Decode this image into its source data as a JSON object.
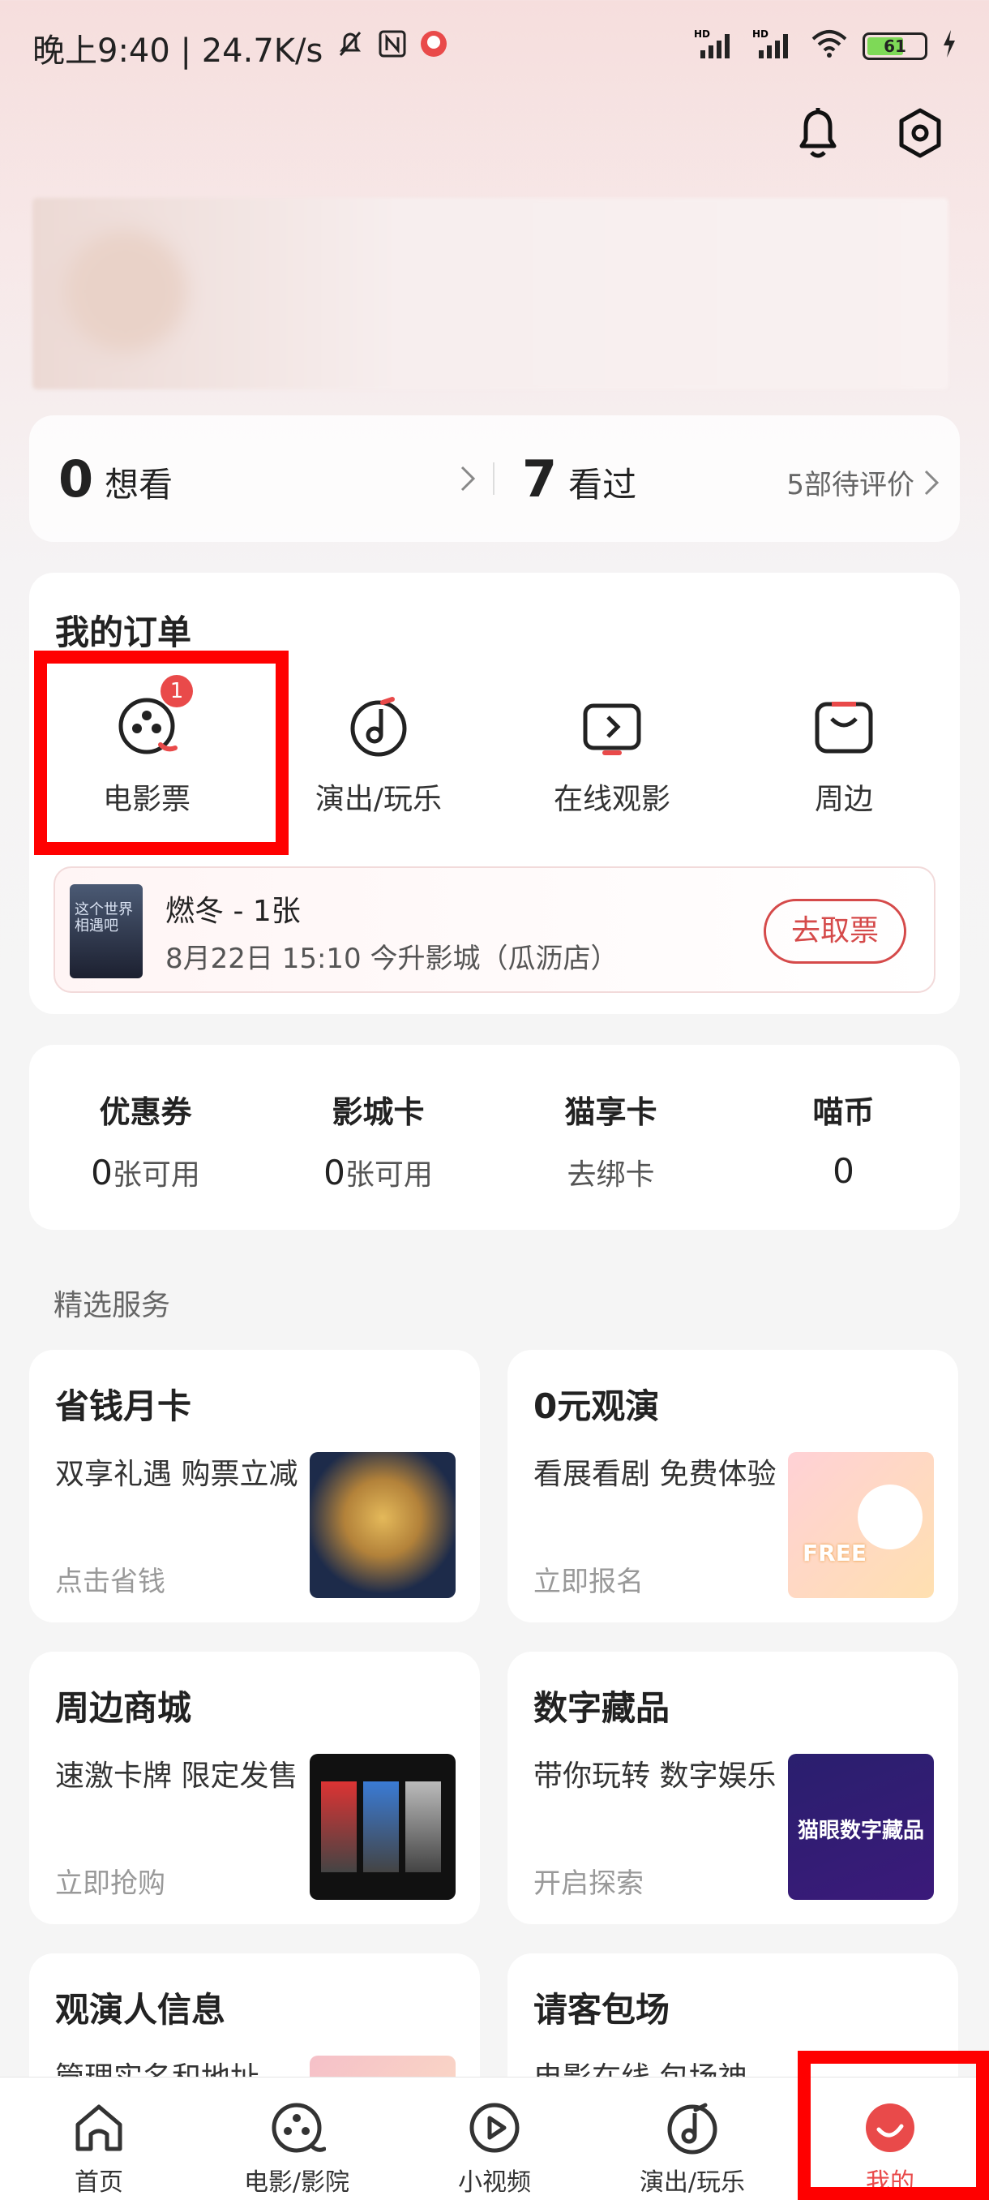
{
  "status_bar": {
    "time_speed": "晚上9:40 | 24.7K/s",
    "battery": "61"
  },
  "stats": {
    "want_count": "0",
    "want_label": "想看",
    "watched_count": "7",
    "watched_label": "看过",
    "pending_reviews": "5部待评价"
  },
  "orders": {
    "title": "我的订单",
    "items": [
      {
        "label": "电影票",
        "badge": "1"
      },
      {
        "label": "演出/玩乐"
      },
      {
        "label": "在线观影"
      },
      {
        "label": "周边"
      }
    ],
    "ticket": {
      "poster_text": "这个世界相遇吧",
      "title": "燃冬 - 1张",
      "info": "8月22日 15:10 今升影城（瓜沥店）",
      "button": "去取票"
    }
  },
  "benefits": [
    {
      "title": "优惠券",
      "count": "0",
      "suffix": "张可用"
    },
    {
      "title": "影城卡",
      "count": "0",
      "suffix": "张可用"
    },
    {
      "title": "猫享卡",
      "count": "",
      "suffix": "去绑卡"
    },
    {
      "title": "喵币",
      "count": "0",
      "suffix": ""
    }
  ],
  "services": {
    "title": "精选服务",
    "cards": [
      {
        "title": "省钱月卡",
        "desc": "双享礼遇 购票立减",
        "action": "点击省钱"
      },
      {
        "title": "0元观演",
        "desc": "看展看剧 免费体验",
        "action": "立即报名",
        "img_text": "FREE"
      },
      {
        "title": "周边商城",
        "desc": "速激卡牌 限定发售",
        "action": "立即抢购"
      },
      {
        "title": "数字藏品",
        "desc": "带你玩转 数字娱乐",
        "action": "开启探索",
        "img_text": "猫眼数字藏品"
      },
      {
        "title": "观演人信息",
        "desc": "管理实名和地址"
      },
      {
        "title": "请客包场",
        "desc": "电影在线 包场神"
      }
    ]
  },
  "bottom_nav": [
    {
      "label": "首页"
    },
    {
      "label": "电影/影院"
    },
    {
      "label": "小视频"
    },
    {
      "label": "演出/玩乐"
    },
    {
      "label": "我的"
    }
  ],
  "colors": {
    "accent": "#e94a4a",
    "highlight_box": "#ff0000"
  }
}
